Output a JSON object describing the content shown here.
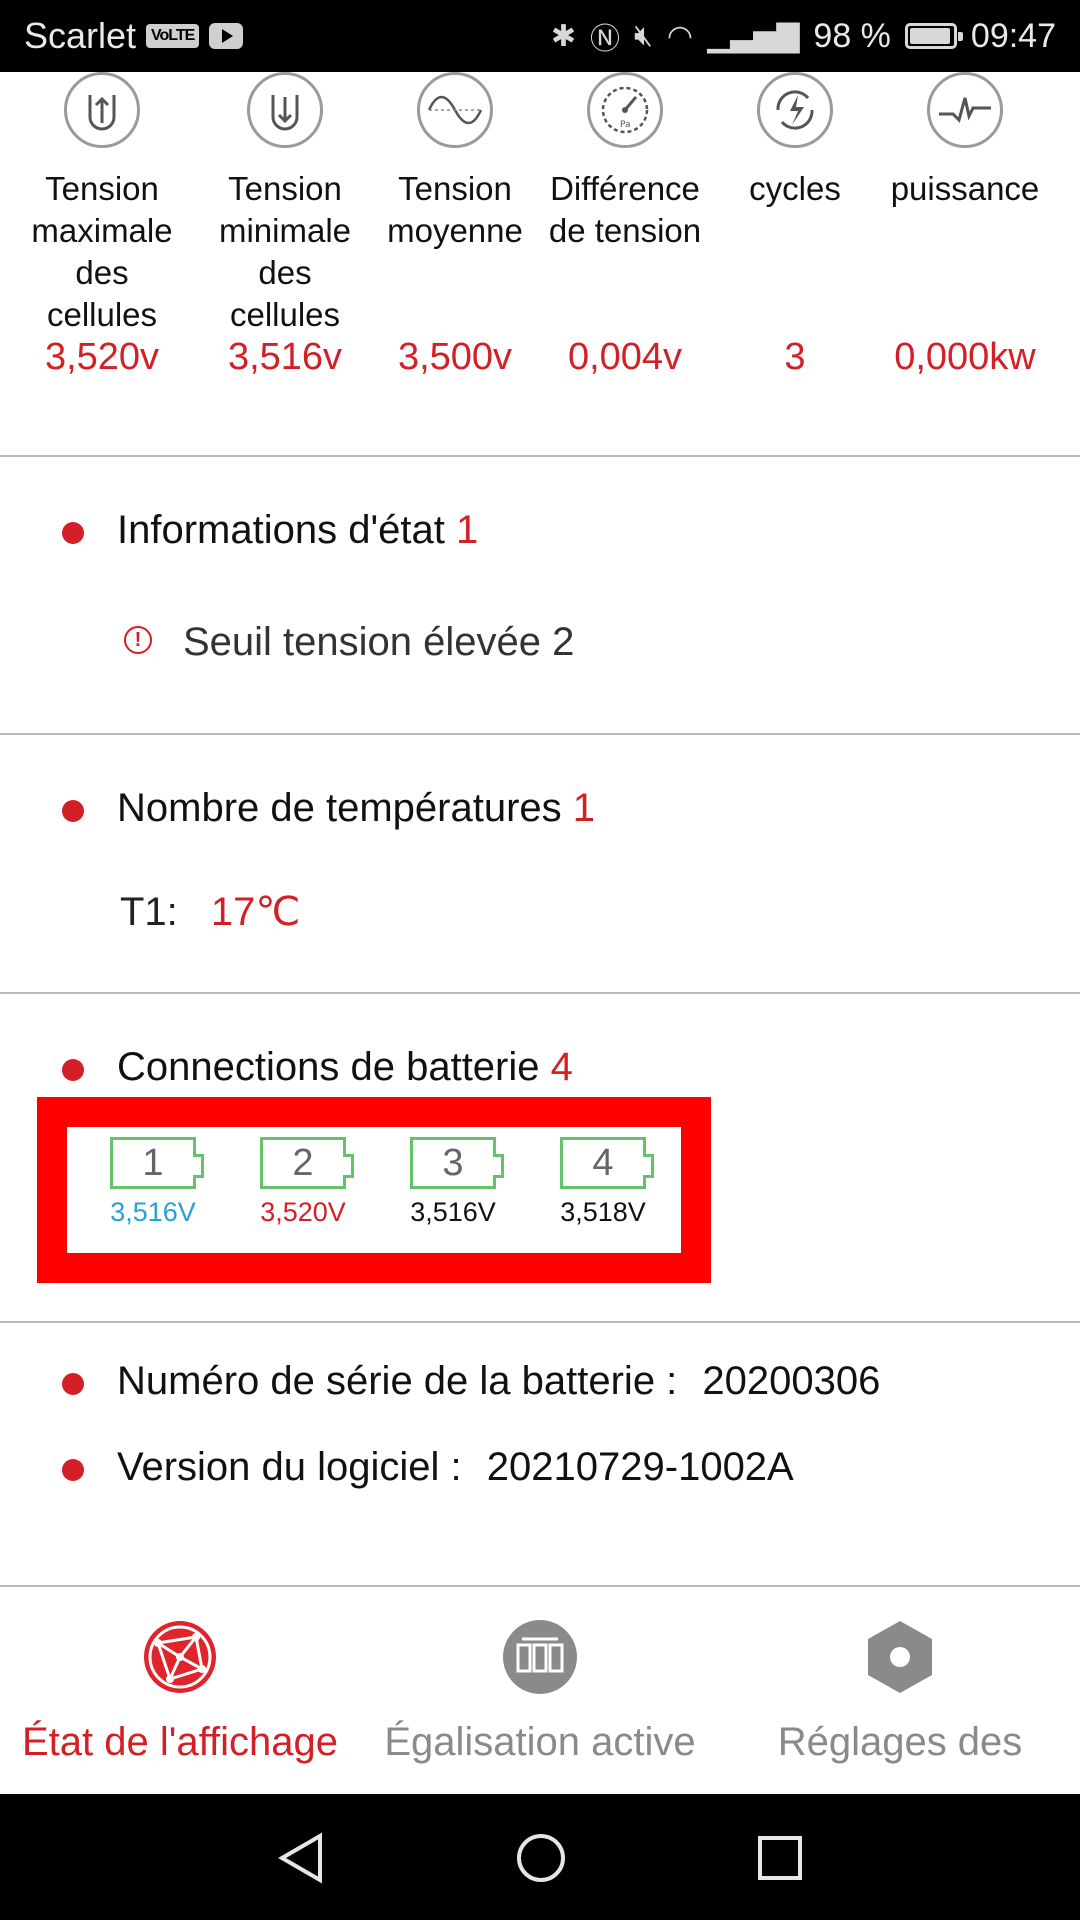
{
  "status_bar": {
    "carrier": "Scarlet",
    "volte": "VoLTE",
    "battery_percent": "98 %",
    "time": "09:47"
  },
  "metrics": [
    {
      "label": "Tension maximale des cellules",
      "value": "3,520v",
      "icon": "voltage-up-icon"
    },
    {
      "label": "Tension minimale des cellules",
      "value": "3,516v",
      "icon": "voltage-down-icon"
    },
    {
      "label": "Tension moyenne",
      "value": "3,500v",
      "icon": "sine-wave-icon"
    },
    {
      "label": "Différence de tension",
      "value": "0,004v",
      "icon": "gauge-icon"
    },
    {
      "label": "cycles",
      "value": "3",
      "icon": "cycle-bolt-icon"
    },
    {
      "label": "puissance",
      "value": "0,000kw",
      "icon": "power-pulse-icon"
    }
  ],
  "status_info": {
    "title": "Informations d'état",
    "count": "1",
    "items": [
      {
        "text": "Seuil tension élevée 2"
      }
    ]
  },
  "temperatures": {
    "title": "Nombre de températures",
    "count": "1",
    "items": [
      {
        "label": "T1:",
        "value": "17℃"
      }
    ]
  },
  "connections": {
    "title": "Connections de batterie",
    "count": "4",
    "cells": [
      {
        "num": "1",
        "voltage": "3,516V",
        "color": "#2a9fd6"
      },
      {
        "num": "2",
        "voltage": "3,520V",
        "color": "#d32027"
      },
      {
        "num": "3",
        "voltage": "3,516V",
        "color": "#111111"
      },
      {
        "num": "4",
        "voltage": "3,518V",
        "color": "#111111"
      }
    ]
  },
  "info": {
    "serial_label": "Numéro de série de la batterie :",
    "serial_value": "20200306",
    "version_label": "Version du logiciel :",
    "version_value": "20210729-1002A"
  },
  "bottom_nav": [
    {
      "label": "État de l'affichage",
      "active": true,
      "icon": "globe-network-icon"
    },
    {
      "label": "Égalisation active",
      "active": false,
      "icon": "balance-cells-icon"
    },
    {
      "label": "Réglages des",
      "active": false,
      "icon": "settings-hex-icon"
    }
  ],
  "colors": {
    "accent": "#d32027",
    "cell_outline": "#66c26a",
    "inactive": "#8a8a8a"
  }
}
